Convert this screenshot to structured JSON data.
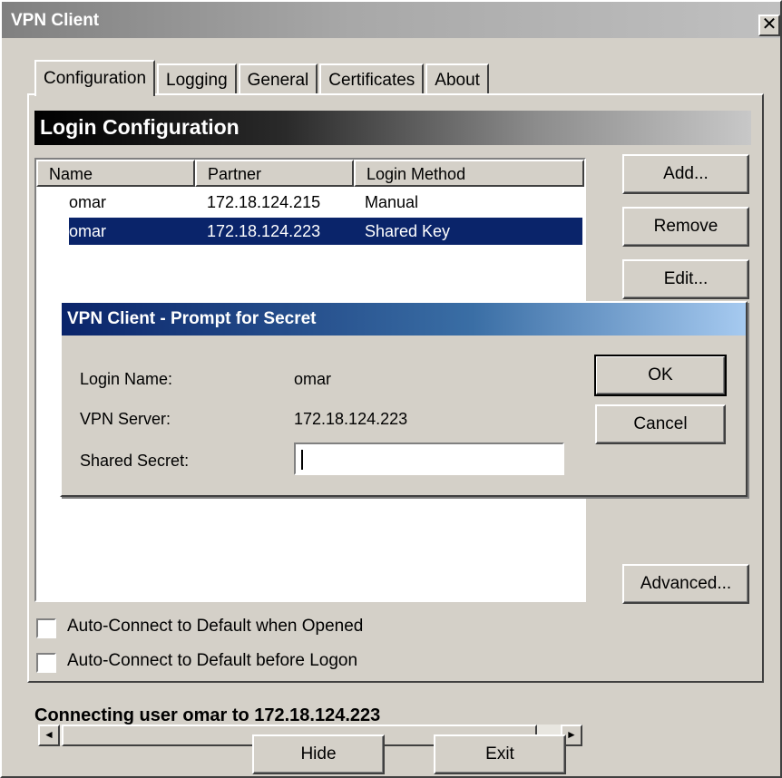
{
  "window": {
    "title": "VPN Client",
    "close_glyph": "✕"
  },
  "tabs": [
    {
      "label": "Configuration",
      "active": true
    },
    {
      "label": "Logging",
      "active": false
    },
    {
      "label": "General",
      "active": false
    },
    {
      "label": "Certificates",
      "active": false
    },
    {
      "label": "About",
      "active": false
    }
  ],
  "section": {
    "title": "Login Configuration"
  },
  "table": {
    "columns": [
      "Name",
      "Partner",
      "Login Method"
    ],
    "rows": [
      {
        "name": "omar",
        "partner": "172.18.124.215",
        "method": "Manual",
        "selected": false
      },
      {
        "name": "omar",
        "partner": "172.18.124.223",
        "method": "Shared Key",
        "selected": true
      }
    ]
  },
  "side_buttons": {
    "add": "Add...",
    "remove": "Remove",
    "edit": "Edit...",
    "advanced": "Advanced..."
  },
  "checkboxes": [
    {
      "label": "Auto-Connect to Default when Opened",
      "checked": false
    },
    {
      "label": "Auto-Connect to Default before Logon",
      "checked": false
    }
  ],
  "status": {
    "text": "Connecting user omar to 172.18.124.223"
  },
  "footer_buttons": {
    "hide": "Hide",
    "exit": "Exit"
  },
  "dialog": {
    "title": "VPN Client - Prompt for Secret",
    "login_name_label": "Login Name:",
    "login_name_value": "omar",
    "vpn_server_label": "VPN Server:",
    "vpn_server_value": "172.18.124.223",
    "shared_secret_label": "Shared Secret:",
    "shared_secret_value": "",
    "ok": "OK",
    "cancel": "Cancel"
  },
  "icons": {
    "scroll_left": "◄",
    "scroll_right": "►"
  },
  "colors": {
    "selection": "#0a246a",
    "dialog_title": "#0a246a",
    "face": "#d4d0c8"
  }
}
